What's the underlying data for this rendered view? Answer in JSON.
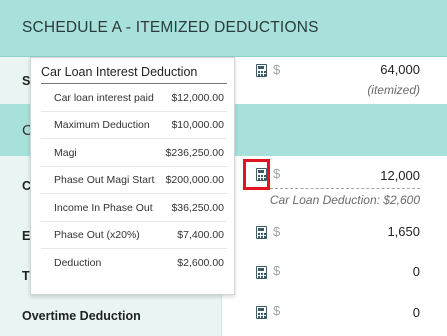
{
  "header": {
    "title": "SCHEDULE A - ITEMIZED DEDUCTIONS"
  },
  "rows": {
    "row1": {
      "label_partial": "S",
      "value": "64,000",
      "note": "(itemized)"
    },
    "section": {
      "label_partial": "C"
    },
    "row2": {
      "label_partial": "C",
      "value": "12,000",
      "note": "Car Loan Deduction: $2,600"
    },
    "row3": {
      "label_partial": "E",
      "value": "1,650"
    },
    "row4": {
      "label_partial": "T",
      "value": "0"
    },
    "row5": {
      "label": "Overtime Deduction",
      "value": "0"
    }
  },
  "currency_symbol": "$",
  "popup": {
    "title": "Car Loan Interest Deduction",
    "items": [
      {
        "label": "Car loan interest paid",
        "value": "$12,000.00"
      },
      {
        "label": "Maximum Deduction",
        "value": "$10,000.00"
      },
      {
        "label": "Magi",
        "value": "$236,250.00"
      },
      {
        "label": "Phase Out Magi Start",
        "value": "$200,000.00"
      },
      {
        "label": "Income In Phase Out",
        "value": "$36,250.00"
      },
      {
        "label": "Phase Out (x20%)",
        "value": "$7,400.00"
      },
      {
        "label": "Deduction",
        "value": "$2,600.00"
      }
    ]
  },
  "colors": {
    "header_bg": "#a8e0dc",
    "left_col_bg": "#e8f5f3",
    "highlight": "#e0141e"
  },
  "icons": {
    "calculator": "calculator-icon"
  }
}
